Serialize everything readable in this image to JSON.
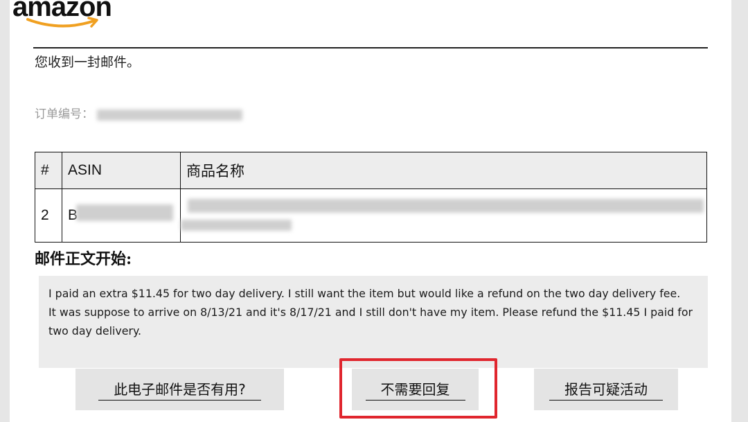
{
  "brand": {
    "logo_text": "amazon",
    "smile_color": "#f0a021"
  },
  "notice": {
    "received_text": "您收到一封邮件。"
  },
  "order": {
    "label": "订单编号：",
    "value_redacted": true
  },
  "items_table": {
    "headers": [
      "#",
      "ASIN",
      "商品名称"
    ],
    "rows": [
      {
        "num": "2",
        "asin_visible": "B",
        "asin_redacted": true,
        "name_redacted": true
      }
    ]
  },
  "message": {
    "heading": "邮件正文开始:",
    "lines": [
      "I paid an extra $11.45 for two day delivery. I still want the item but would like a refund on the two day delivery fee.",
      "It was suppose to arrive on 8/13/21 and it's 8/17/21 and I still don't have my item. Please refund the $11.45 I paid for two day delivery."
    ]
  },
  "actions": {
    "useful_label": "此电子邮件是否有用?",
    "no_reply_label": "不需要回复",
    "report_label": "报告可疑活动"
  },
  "colors": {
    "highlight": "#e0262e",
    "button_bg": "#e4e4e4",
    "message_bg": "#ececec"
  }
}
